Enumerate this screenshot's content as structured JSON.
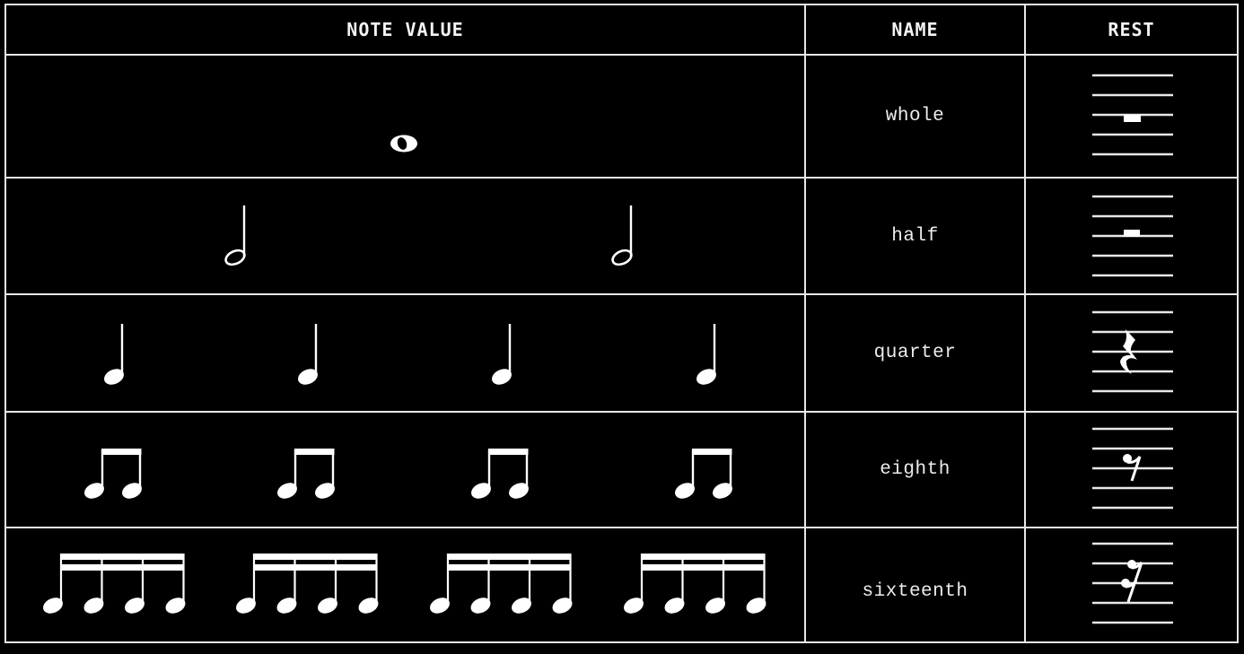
{
  "table": {
    "headers": {
      "note_value": "NOTE VALUE",
      "name": "NAME",
      "rest": "REST"
    },
    "rows": [
      {
        "name": "whole",
        "note_type": "whole",
        "note_count": 1,
        "rest_icon": "whole-rest-icon"
      },
      {
        "name": "half",
        "note_type": "half",
        "note_count": 2,
        "rest_icon": "half-rest-icon"
      },
      {
        "name": "quarter",
        "note_type": "quarter",
        "note_count": 4,
        "rest_icon": "quarter-rest-icon"
      },
      {
        "name": "eighth",
        "note_type": "eighth",
        "note_count": 4,
        "rest_icon": "eighth-rest-icon",
        "notes_per_group": 2
      },
      {
        "name": "sixteenth",
        "note_type": "sixteenth",
        "note_count": 4,
        "rest_icon": "sixteenth-rest-icon",
        "notes_per_group": 4
      }
    ]
  },
  "colors": {
    "background": "#000000",
    "foreground": "#ffffff",
    "grid": "#e8e8e8"
  }
}
